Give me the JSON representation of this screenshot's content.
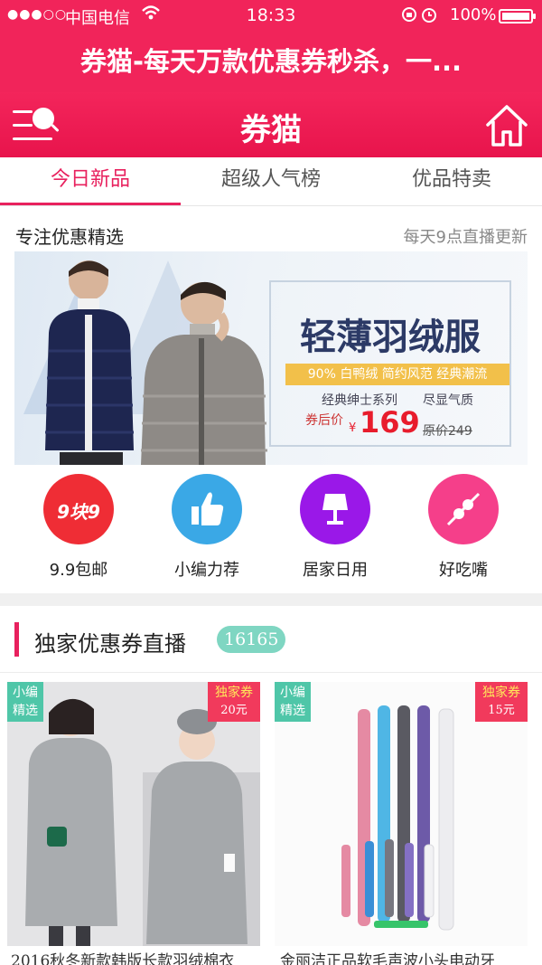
{
  "status_bar": {
    "signal": "●●●○○",
    "carrier": "中国电信",
    "time": "18:33",
    "battery": "100%"
  },
  "title_banner": "券猫-每天万款优惠券秒杀，一...",
  "nav": {
    "brand": "券猫"
  },
  "tabs": [
    {
      "label": "今日新品",
      "active": true
    },
    {
      "label": "超级人气榜",
      "active": false
    },
    {
      "label": "优品特卖",
      "active": false
    }
  ],
  "featured": {
    "heading": "专注优惠精选",
    "subheading": "每天9点直播更新"
  },
  "promo_banner": {
    "headline": "轻薄羽绒服",
    "stripe": "90% 白鸭绒 简约风范 经典潮流",
    "series": "经典绅士系列　　尽显气质",
    "price_label": "券后价",
    "currency": "¥",
    "price": "169",
    "original": "原价249"
  },
  "categories": [
    {
      "label": "9.9包邮",
      "icon": "nine-nine-icon",
      "icon_text": "9块9",
      "color": "#ef2d35"
    },
    {
      "label": "小编力荐",
      "icon": "thumbs-up-icon",
      "color": "#3aa8e6"
    },
    {
      "label": "居家日用",
      "icon": "lamp-icon",
      "color": "#9a18e8"
    },
    {
      "label": "好吃嘴",
      "icon": "skewer-food-icon",
      "color": "#f53f8a"
    }
  ],
  "exclusive": {
    "heading": "独家优惠券直播",
    "count": "16165"
  },
  "products": [
    {
      "pick_tag": "小编\n精选",
      "pick_tag_l1": "小编",
      "pick_tag_l2": "精选",
      "coupon_tag": "独家券",
      "coupon_amount": "20元",
      "title": "2016秋冬新款韩版长款羽绒棉衣"
    },
    {
      "pick_tag_l1": "小编",
      "pick_tag_l2": "精选",
      "coupon_tag": "独家券",
      "coupon_amount": "15元",
      "title": "金丽洁正品软毛声波小头电动牙"
    }
  ],
  "colors": {
    "brand": "#f1245a",
    "accent": "#e8215e",
    "badge": "#7fd6c2",
    "pick_tag": "#4fc6a8",
    "coupon_tag": "#f13a5c"
  }
}
